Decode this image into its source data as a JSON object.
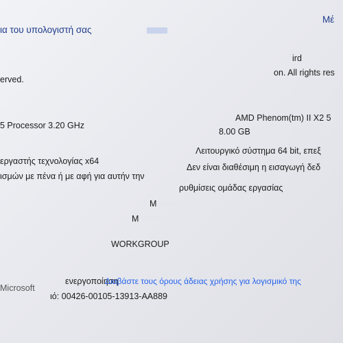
{
  "header": {
    "title": "ια του υπολογιστή σας",
    "title_link_tail": "",
    "right_heading": "Μέ"
  },
  "edition": {
    "name_fragment": "ird",
    "copyright_fragment": "on. All rights res",
    "copyright_tail": "erved."
  },
  "system": {
    "processor_name": "AMD Phenom(tm) II X2 5",
    "processor_speed": "5 Processor 3.20 GHz",
    "memory": "8.00 GB",
    "system_type_value": "Λειτουργικό σύστημα 64 bit, επεξ",
    "system_type_label": "εργαστής τεχνολογίας x64",
    "pen_touch_value": "Δεν είναι διαθέσιμη η εισαγωγή δεδ",
    "pen_touch_label": "ισμών με πένα ή με αφή για αυτήν την"
  },
  "computer_name": {
    "section_heading": "ρυθμίσεις ομάδας εργασίας",
    "computer_name_value": "M",
    "full_name_value": "M",
    "workgroup_value": "WORKGROUP"
  },
  "activation": {
    "status_fragment": "ενεργοποίηση",
    "license_link": "Διαβάστε τους όρους άδειας χρήσης για λογισμικό της",
    "microsoft_fragment": "Microsoft",
    "product_id": "ιό: 00426-00105-13913-AA889"
  }
}
